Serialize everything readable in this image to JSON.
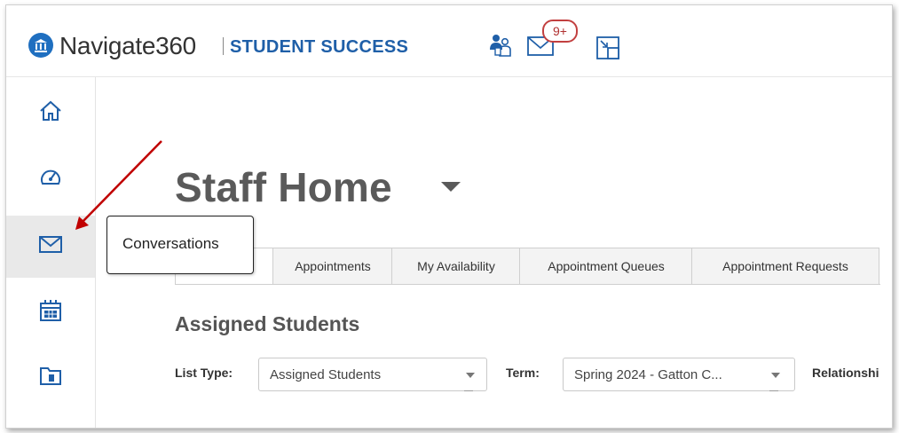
{
  "header": {
    "brand": "Navigate360",
    "product": "STUDENT SUCCESS",
    "badge_count": "9+",
    "icons": [
      "logo-icon",
      "students-icon",
      "messages-icon",
      "resize-icon"
    ]
  },
  "sidebar": {
    "items": [
      {
        "name": "home",
        "icon": "home-icon"
      },
      {
        "name": "dashboard",
        "icon": "speedometer-icon"
      },
      {
        "name": "conversations",
        "icon": "envelope-icon",
        "active": true
      },
      {
        "name": "calendar",
        "icon": "calendar-icon"
      },
      {
        "name": "folders",
        "icon": "folder-icon"
      }
    ],
    "tooltip": "Conversations"
  },
  "main": {
    "title": "Staff Home",
    "tabs": [
      {
        "label": ""
      },
      {
        "label": "Appointments"
      },
      {
        "label": "My Availability"
      },
      {
        "label": "Appointment Queues"
      },
      {
        "label": "Appointment Requests"
      }
    ],
    "section_title": "Assigned Students",
    "filters": {
      "list_type_label": "List Type:",
      "list_type_value": "Assigned Students",
      "term_label": "Term:",
      "term_value": "Spring 2024 - Gatton C...",
      "relationship_label": "Relationshi"
    }
  },
  "colors": {
    "brand_blue": "#1f5fa8",
    "logo_blue": "#1f6fc0",
    "badge_red": "#c24040",
    "annotation_arrow": "#c00000"
  }
}
